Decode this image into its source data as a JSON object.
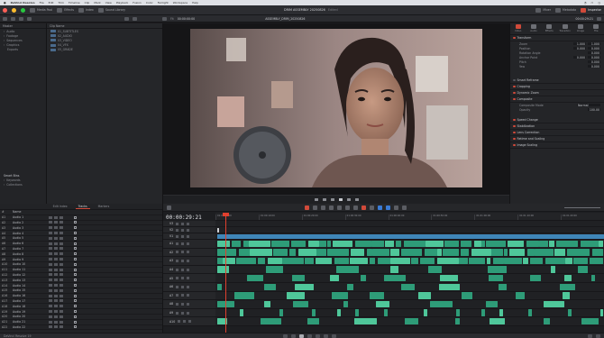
{
  "mac_menu": {
    "app": "DaVinci Resolve",
    "items": [
      "File",
      "Edit",
      "Trim",
      "Timeline",
      "Clip",
      "Mark",
      "View",
      "Playback",
      "Fusion",
      "Color",
      "Fairlight",
      "Workspace",
      "Help"
    ]
  },
  "titlebar": {
    "buttons": [
      "Media Pool",
      "Effects",
      "Index",
      "Sound Library"
    ],
    "project_title": "DRIM ASSEMBLY 20250826",
    "project_state": "Edited",
    "right_buttons": [
      "Mixer",
      "Metadata",
      "Inspector"
    ]
  },
  "viewer": {
    "left_tc": "00:00:00:00",
    "clip_name": "ASSEMBLY_DRIM_20250826",
    "zoom": "Fit",
    "right_tc": "00:00:29:21"
  },
  "bins": {
    "header": "Master",
    "items": [
      "Audio",
      "Footage",
      "Sequences",
      "Graphics",
      "Exports"
    ],
    "smart_header": "Smart Bins",
    "smart_items": [
      "Keywords",
      "Collections"
    ]
  },
  "pool": {
    "header": "Clip Name",
    "items": [
      "01_SUBTITLES",
      "02_AUDIO",
      "03_VIDEO",
      "04_VFX",
      "05_GRADE"
    ]
  },
  "inspector": {
    "tabs": [
      "Video",
      "Audio",
      "Effects",
      "Transition",
      "Image",
      "File"
    ],
    "section_transform": "Transform",
    "props": [
      {
        "label": "Zoom",
        "x": "1.000",
        "y": "1.000"
      },
      {
        "label": "Position",
        "x": "0.000",
        "y": "0.000"
      },
      {
        "label": "Rotation Angle",
        "x": "0.000",
        "y": ""
      },
      {
        "label": "Anchor Point",
        "x": "0.000",
        "y": "0.000"
      },
      {
        "label": "Pitch",
        "x": "0.000",
        "y": ""
      },
      {
        "label": "Yaw",
        "x": "0.000",
        "y": ""
      }
    ],
    "section_smart": "Smart Reframe",
    "section_crop": "Cropping",
    "section_dynamic": "Dynamic Zoom",
    "section_composite": "Composite",
    "composite_mode_label": "Composite Mode",
    "composite_mode": "Normal",
    "opacity_label": "Opacity",
    "opacity": "100.00",
    "section_speed": "Speed Change",
    "section_stab": "Stabilization",
    "section_lens": "Lens Correction",
    "section_retime": "Retime and Scaling",
    "section_image": "Image Scaling"
  },
  "lower_left": {
    "tabs": [
      "Edit Index",
      "Tracks",
      "Markers"
    ],
    "active_tab": "Tracks",
    "columns": [
      "#",
      "Name"
    ],
    "rows": [
      {
        "n": "A1",
        "name": "Audio 1"
      },
      {
        "n": "A2",
        "name": "Audio 2"
      },
      {
        "n": "A3",
        "name": "Audio 3"
      },
      {
        "n": "A4",
        "name": "Audio 4"
      },
      {
        "n": "A5",
        "name": "Audio 5"
      },
      {
        "n": "A6",
        "name": "Audio 6"
      },
      {
        "n": "A7",
        "name": "Audio 7"
      },
      {
        "n": "A8",
        "name": "Audio 8"
      },
      {
        "n": "A9",
        "name": "Audio 9"
      },
      {
        "n": "A10",
        "name": "Audio 10"
      },
      {
        "n": "A11",
        "name": "Audio 11"
      },
      {
        "n": "A12",
        "name": "Audio 12"
      },
      {
        "n": "A13",
        "name": "Audio 13"
      },
      {
        "n": "A14",
        "name": "Audio 14"
      },
      {
        "n": "A15",
        "name": "Audio 15"
      },
      {
        "n": "A16",
        "name": "Audio 16"
      },
      {
        "n": "A17",
        "name": "Audio 17"
      },
      {
        "n": "A18",
        "name": "Audio 18"
      },
      {
        "n": "A19",
        "name": "Audio 19"
      },
      {
        "n": "A20",
        "name": "Audio 20"
      },
      {
        "n": "A21",
        "name": "Audio 21"
      },
      {
        "n": "A22",
        "name": "Audio 22"
      }
    ]
  },
  "timeline": {
    "timecode": "00:00:29:21",
    "ruler": [
      "01:00:00:00",
      "01:00:10:00",
      "01:00:20:00",
      "01:00:30:00",
      "01:00:40:00",
      "01:00:50:00",
      "01:01:00:00",
      "01:01:10:00",
      "01:01:20:00"
    ],
    "tracks": [
      {
        "id": "V3",
        "type": "video"
      },
      {
        "id": "V2",
        "type": "video"
      },
      {
        "id": "V1",
        "type": "video"
      },
      {
        "id": "A1",
        "type": "audio"
      },
      {
        "id": "A2",
        "type": "audio"
      },
      {
        "id": "A3",
        "type": "audio"
      },
      {
        "id": "A4",
        "type": "audio"
      },
      {
        "id": "A5",
        "type": "audio"
      },
      {
        "id": "A6",
        "type": "audio"
      },
      {
        "id": "A7",
        "type": "audio"
      },
      {
        "id": "A8",
        "type": "audio"
      },
      {
        "id": "A9",
        "type": "audio"
      },
      {
        "id": "A10",
        "type": "audio"
      }
    ]
  },
  "statusbar": {
    "app_label": "DaVinci Resolve 19",
    "pages": [
      "Media",
      "Cut",
      "Edit",
      "Fusion",
      "Color",
      "Fairlight",
      "Deliver"
    ],
    "active_page": "Edit"
  },
  "colors": {
    "accent": "#d14a3a",
    "video_clip": "#3f86b8",
    "audio_clip": "#2e9c78",
    "audio_clip_light": "#4fc79a",
    "playhead": "#e0402e"
  }
}
